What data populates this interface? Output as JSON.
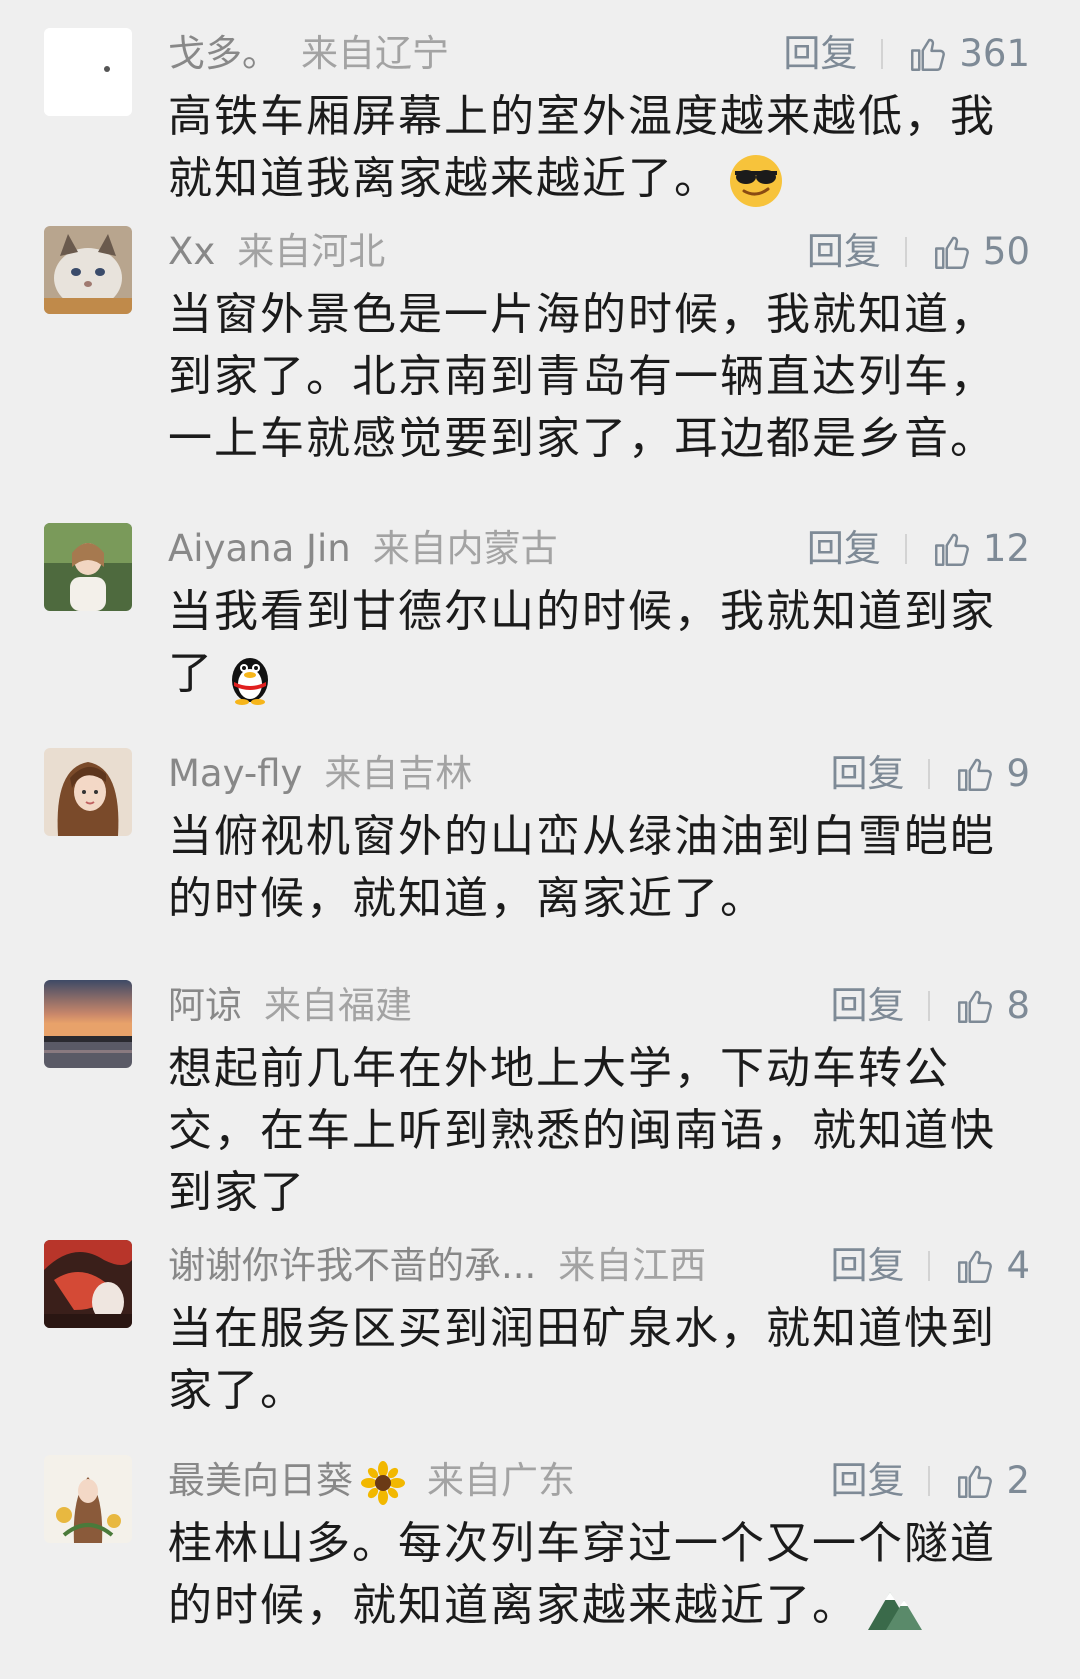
{
  "labels": {
    "reply": "回复"
  },
  "comments": [
    {
      "username": "戈多。",
      "region": "来自辽宁",
      "likes": "361",
      "text": "高铁车厢屏幕上的室外温度越来越低，我就知道我离家越来越近了。",
      "emoji": "sunglasses-face"
    },
    {
      "username": "Xx",
      "region": "来自河北",
      "likes": "50",
      "text": "当窗外景色是一片海的时候，我就知道，到家了。北京南到青岛有一辆直达列车，一上车就感觉要到家了，耳边都是乡音。"
    },
    {
      "username": "Aiyana Jin",
      "region": "来自内蒙古",
      "likes": "12",
      "text": "当我看到甘德尔山的时候，我就知道到家了",
      "emoji": "penguin"
    },
    {
      "username": "May-fly",
      "region": "来自吉林",
      "likes": "9",
      "text": "当俯视机窗外的山峦从绿油油到白雪皑皑的时候，就知道，离家近了。"
    },
    {
      "username": "阿谅",
      "region": "来自福建",
      "likes": "8",
      "text": "想起前几年在外地上大学，下动车转公交，在车上听到熟悉的闽南语，就知道快到家了"
    },
    {
      "username": "谢谢你许我不啬的承...",
      "region": "来自江西",
      "likes": "4",
      "text": "当在服务区买到润田矿泉水，就知道快到家了。"
    },
    {
      "username": "最美向日葵",
      "region": "来自广东",
      "likes": "2",
      "text": "桂林山多。每次列车穿过一个又一个隧道的时候，就知道离家越来越近了。",
      "emoji": "mountain",
      "name_emoji": "sunflower"
    }
  ]
}
